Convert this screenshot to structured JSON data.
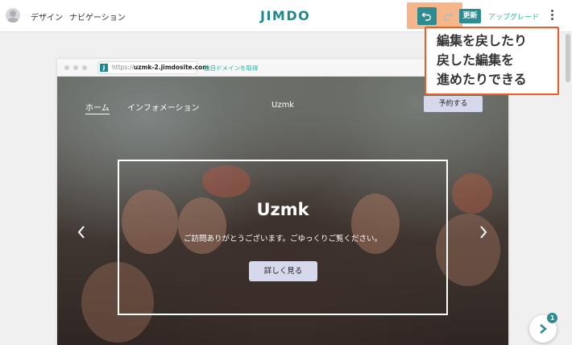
{
  "header": {
    "nav_design": "デザイン",
    "nav_navigation": "ナビゲーション",
    "logo": "JIMDO",
    "update_label": "更新",
    "upgrade_label": "アップグレード"
  },
  "callout": {
    "lines": [
      "編集を戻したり",
      "戻した編集を",
      "進めたりできる"
    ]
  },
  "browser": {
    "url_protocol": "https://",
    "url_host": "uzmk-2.jimdosite.com",
    "domain_link": "独自ドメインを取得"
  },
  "site": {
    "nav": [
      "ホーム",
      "インフォメーション"
    ],
    "site_name": "Uzmk",
    "reserve_button": "予約する",
    "hero_title": "Uzmk",
    "hero_subtitle": "ご訪問ありがとうございます。ごゆっくりご覧ください。",
    "detail_button": "詳しく見る"
  },
  "help": {
    "badge_count": "1"
  },
  "colors": {
    "brand": "#1e8a8f",
    "accent": "#2ab5a4",
    "callout_border": "#f15a22",
    "highlight": "#f7b68a"
  },
  "icons": [
    "user-avatar-icon",
    "undo-icon",
    "redo-icon",
    "more-vertical-icon",
    "chevron-left-icon",
    "chevron-right-icon",
    "help-chevron-icon"
  ]
}
